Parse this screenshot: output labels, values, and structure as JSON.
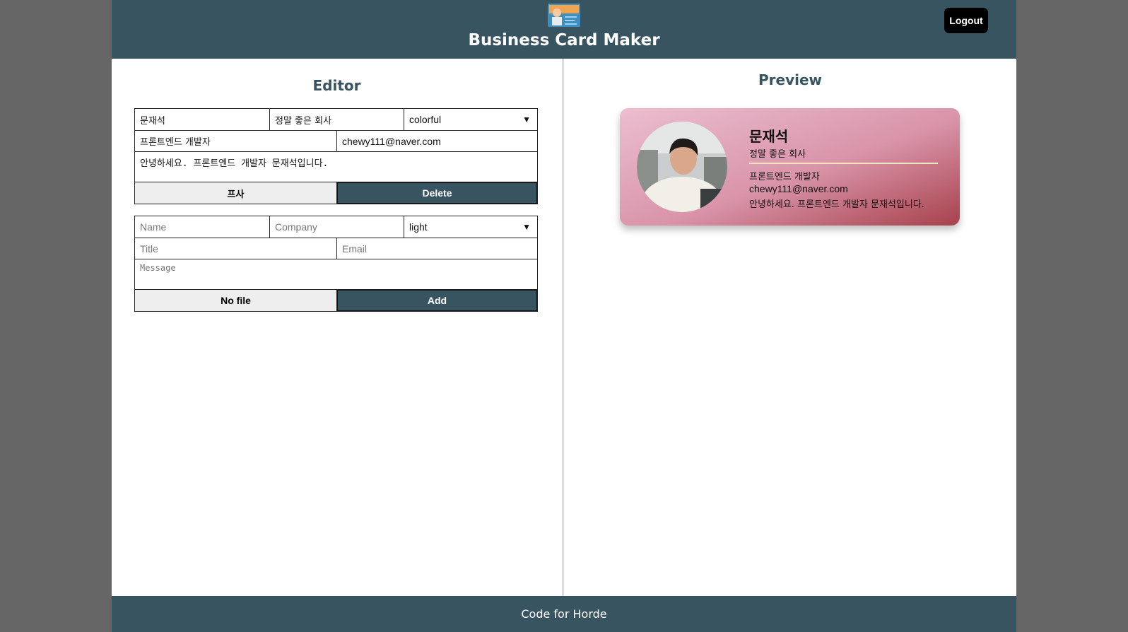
{
  "header": {
    "title": "Business Card Maker",
    "logout_label": "Logout",
    "logo_icon": "business-card-logo-icon"
  },
  "editor": {
    "title": "Editor",
    "card_form": {
      "name": "문재석",
      "company": "정말 좋은 회사",
      "theme": "colorful",
      "title": "프론트엔드 개발자",
      "email": "chewy111@naver.com",
      "message": "안녕하세요. 프론트엔드 개발자 문재석입니다.",
      "file_label": "프사",
      "delete_label": "Delete"
    },
    "add_form": {
      "name_placeholder": "Name",
      "company_placeholder": "Company",
      "theme": "light",
      "title_placeholder": "Title",
      "email_placeholder": "Email",
      "message_placeholder": "Message",
      "file_label": "No file",
      "add_label": "Add"
    }
  },
  "preview": {
    "title": "Preview",
    "card": {
      "name": "문재석",
      "company": "정말 좋은 회사",
      "title": "프론트엔드 개발자",
      "email": "chewy111@naver.com",
      "message": "안녕하세요. 프론트엔드 개발자 문재석입니다."
    }
  },
  "footer": {
    "text": "Code for Horde"
  },
  "colors": {
    "brand": "#385461",
    "page_bg": "#666666",
    "card_gradient_start": "#ebbed0",
    "card_gradient_end": "#a7414c"
  }
}
